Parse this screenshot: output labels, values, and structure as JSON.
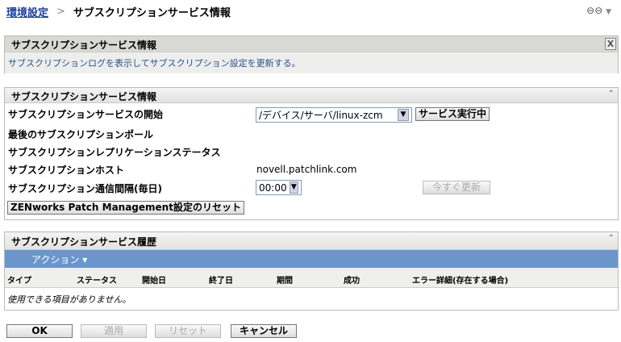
{
  "breadcrumb": {
    "parent": "環境設定",
    "separator": ">",
    "current": "サブスクリプションサービス情報"
  },
  "top_icons": {
    "link": "⊖⊖",
    "dropdown": "▼"
  },
  "info_panel": {
    "title": "サブスクリプションサービス情報",
    "close": "X",
    "description": "サブスクリプションログを表示してサブスクリプション設定を更新する。"
  },
  "settings_panel": {
    "title": "サブスクリプションサービス情報",
    "collapse": "⌃",
    "start_label": "サブスクリプションサービスの開始",
    "start_select": "/デバイス/サーバ/linux-zcm",
    "service_running_btn": "サービス実行中",
    "last_poll_label": "最後のサブスクリプションポール",
    "replication_label": "サブスクリプションレプリケーションステータス",
    "host_label": "サブスクリプションホスト",
    "host_value": "novell.patchlink.com",
    "interval_label": "サブスクリプション通信間隔(毎日)",
    "interval_select": "00:00",
    "update_now_btn": "今すぐ更新",
    "reset_btn": "ZENworks Patch Management設定のリセット"
  },
  "history_panel": {
    "title": "サブスクリプションサービス履歴",
    "collapse": "⌃",
    "action_menu": "アクション ▾",
    "columns": [
      "タイプ",
      "ステータス",
      "開始日",
      "終了日",
      "期間",
      "成功",
      "エラー詳細(存在する場合)"
    ],
    "empty_message": "使用できる項目がありません。"
  },
  "buttons": {
    "ok": "OK",
    "apply": "適用",
    "reset": "リセット",
    "cancel": "キャンセル"
  }
}
